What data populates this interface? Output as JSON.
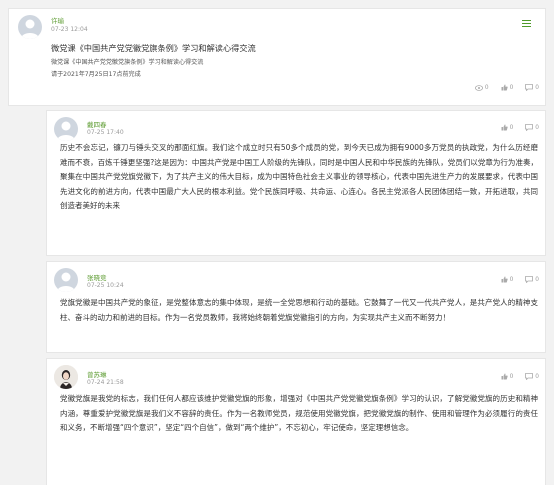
{
  "post": {
    "author": "许瑜",
    "time": "07-23 12:04",
    "title": "微党课《中国共产党党徽党旗条例》学习和解读心得交流",
    "subtitle": "微党课《中国共产党党徽党旗条例》学习和解读心得交流",
    "deadline": "请于2021年7月25日17点前完成",
    "views": "0",
    "likes": "0",
    "comments": "0"
  },
  "replies": [
    {
      "author": "戴四春",
      "time": "07-25 17:40",
      "content": "历史不会忘记，镰刀与锤头交叉的那面红旗。我们这个成立时只有50多个成员的党，到今天已成为拥有9000多万党员的执政党，为什么历经磨难而不衰，百炼千锤更坚强?这是因为：中国共产党是中国工人阶级的先锋队，同时是中国人民和中华民族的先锋队，党员们以党章为行为准奏，聚集在中国共产党党旗党徽下，为了共产主义的伟大目标，成为中国特色社会主义事业的领导核心，代表中国先进生产力的发展要求，代表中国先进文化的前进方向，代表中国最广大人民的根本利益。党个民族同呼吸、共命运、心连心。各民主党派各人民团体团结一致，开拓进取，共同创造者美好的未来",
      "likes": "0",
      "comments": "0"
    },
    {
      "author": "张晓竞",
      "time": "07-25 10:24",
      "content": "党旗党徽是中国共产党的象征，是党整体意志的集中体现，是统一全党思想和行动的基础。它鼓舞了一代又一代共产党人，是共产党人的精神支柱、奋斗的动力和前进的目标。作为一名党员教师，我将始终朝着党旗党徽指引的方向，为实现共产主义而不断努力！",
      "likes": "0",
      "comments": "0"
    },
    {
      "author": "曾苏琳",
      "time": "07-24 21:58",
      "content": "党徽党旗是我党的标志，我们任何人都应该维护党徽党旗的形象，增强对《中国共产党党徽党旗条例》学习的认识，了解党徽党旗的历史和精神内涵，尊重爱护党徽党旗是我们义不容辞的责任。作为一名教师党员，规范使用党徽党旗，把党徽党旗的制作、使用和管理作为必须履行的责任和义务，不断增强“四个意识”，坚定“四个自信”，做到“两个维护”，不忘初心，牢记使命，坚定理想信念。",
      "likes": "0",
      "comments": "0"
    }
  ],
  "colors": {
    "author": "#5a9a2e",
    "menu": "#4f9a2a",
    "background": "#f2f2f2"
  },
  "icons": {
    "view": "eye-icon",
    "like": "thumb-up-icon",
    "comment": "comment-icon",
    "menu": "menu-icon"
  }
}
